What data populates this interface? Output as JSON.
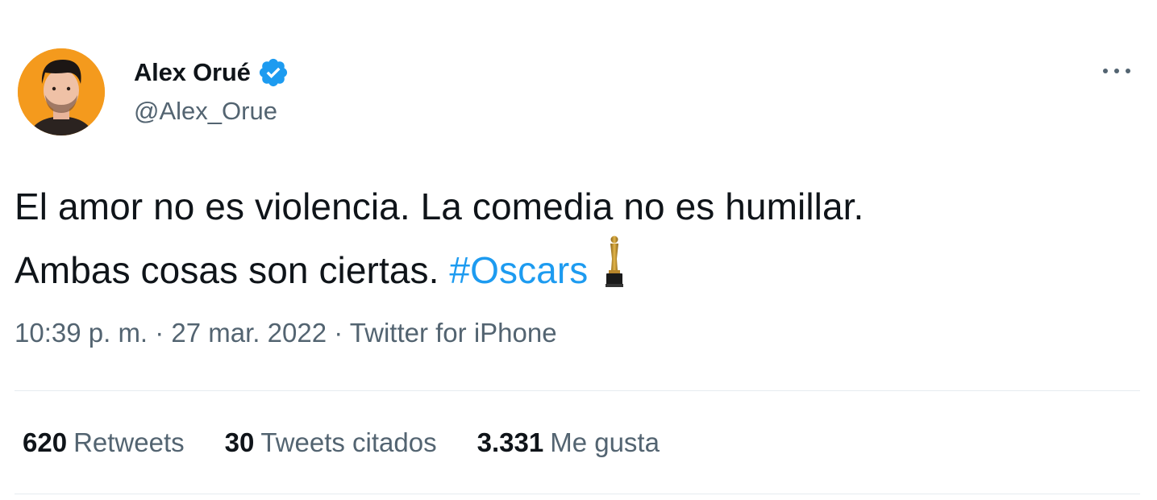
{
  "tweet": {
    "author": {
      "display_name": "Alex Orué",
      "handle": "@Alex_Orue",
      "verified": true,
      "avatar_bg": "#f49a1d"
    },
    "text_line1": "El amor no es violencia. La comedia no es humillar.",
    "text_line2": "Ambas cosas son ciertas.",
    "hashtag": "#Oscars",
    "emoji": "oscar-trophy-icon",
    "meta": "10:39 p. m. · 27 mar. 2022 · Twitter for iPhone",
    "stats": [
      {
        "num": "620",
        "label": "Retweets"
      },
      {
        "num": "30",
        "label": "Tweets citados"
      },
      {
        "num": "3.331",
        "label": "Me gusta"
      }
    ],
    "colors": {
      "text": "#0f1419",
      "secondary": "#536471",
      "link": "#1d9bf0",
      "divider": "#e6ecf0"
    }
  }
}
